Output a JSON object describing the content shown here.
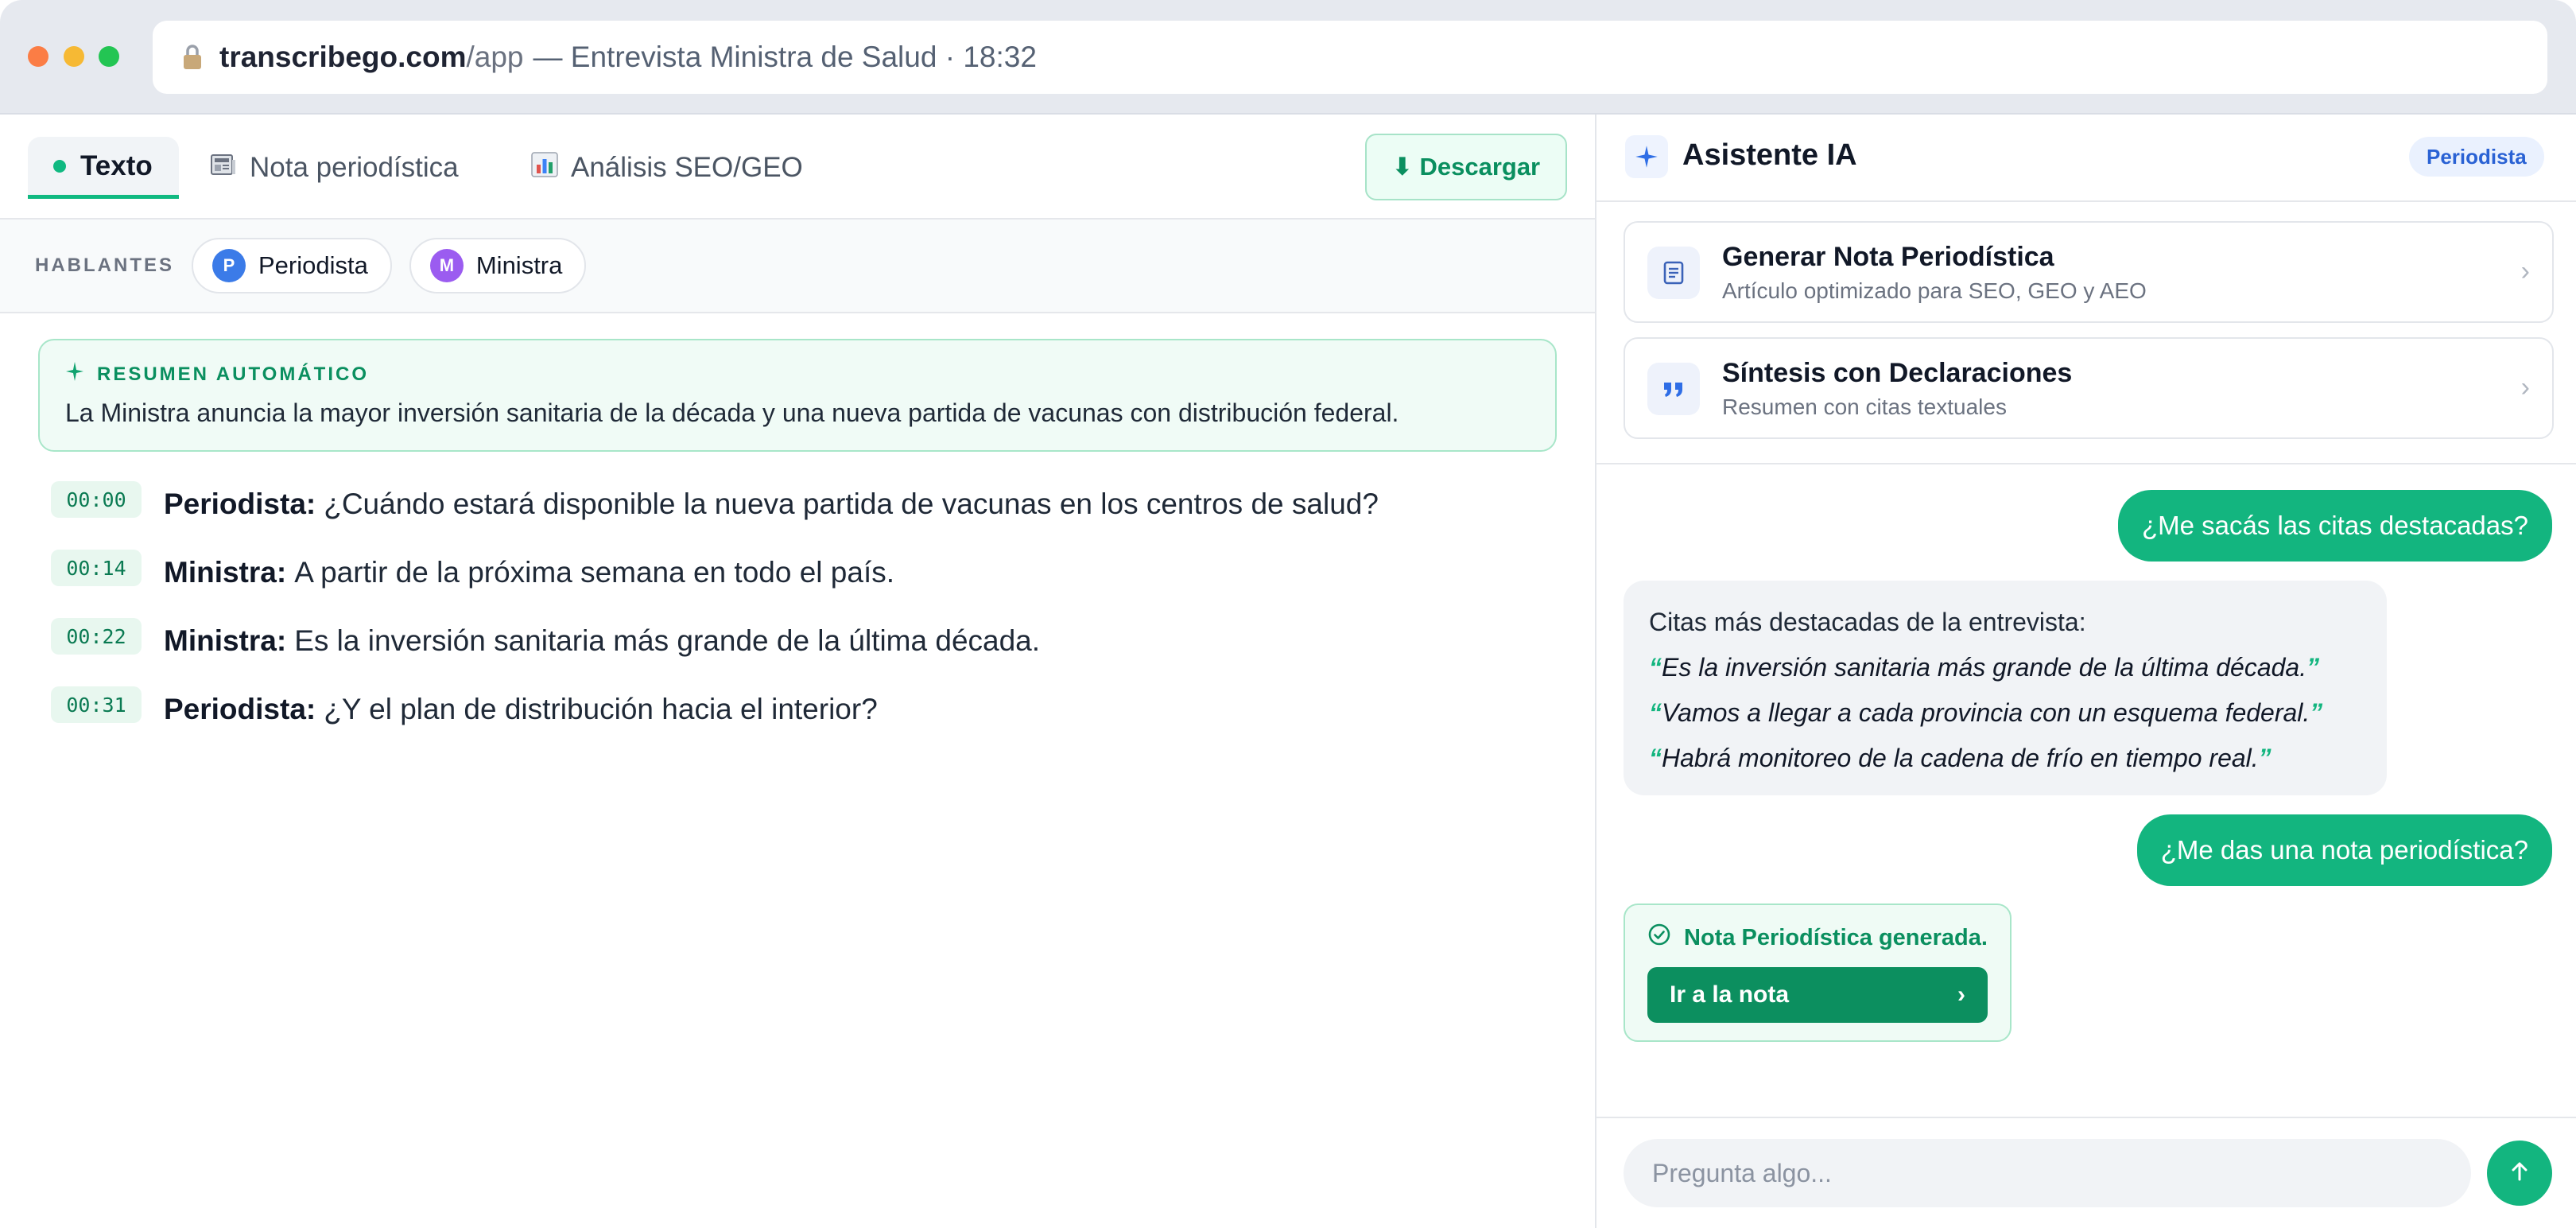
{
  "browser": {
    "url_host": "transcribego.com",
    "url_path": "/app",
    "page_title": "— Entrevista Ministra de Salud · 18:32"
  },
  "tabs": [
    {
      "label": "Texto",
      "icon": "dot-icon",
      "active": true
    },
    {
      "label": "Nota periodística",
      "icon": "newspaper-icon",
      "active": false
    },
    {
      "label": "Análisis SEO/GEO",
      "icon": "bar-chart-icon",
      "active": false
    }
  ],
  "download_label": "⬇ Descargar",
  "speakers": {
    "label": "HABLANTES",
    "items": [
      {
        "initial": "P",
        "name": "Periodista",
        "color": "#3b7be8"
      },
      {
        "initial": "M",
        "name": "Ministra",
        "color": "#9b5cf0"
      }
    ]
  },
  "summary": {
    "title": "RESUMEN AUTOMÁTICO",
    "text": "La Ministra anuncia la mayor inversión sanitaria de la década y una nueva partida de vacunas con distribución federal."
  },
  "transcript": [
    {
      "time": "00:00",
      "speaker": "Periodista:",
      "text": "¿Cuándo estará disponible la nueva partida de vacunas en los centros de salud?"
    },
    {
      "time": "00:14",
      "speaker": "Ministra:",
      "text": "A partir de la próxima semana en todo el país."
    },
    {
      "time": "00:22",
      "speaker": "Ministra:",
      "text": "Es la inversión sanitaria más grande de la última década."
    },
    {
      "time": "00:31",
      "speaker": "Periodista:",
      "text": "¿Y el plan de distribución hacia el interior?"
    }
  ],
  "assistant": {
    "title": "Asistente IA",
    "badge": "Periodista",
    "actions": [
      {
        "title": "Generar Nota Periodística",
        "subtitle": "Artículo optimizado para SEO, GEO y AEO",
        "icon": "document-icon"
      },
      {
        "title": "Síntesis con Declaraciones",
        "subtitle": "Resumen con citas textuales",
        "icon": "quote-icon"
      }
    ],
    "chat": {
      "user_1": "¿Me sacás las citas destacadas?",
      "bot_intro": "Citas más destacadas de la entrevista:",
      "quotes": [
        "Es la inversión sanitaria más grande de la última década.",
        "Vamos a llegar a cada provincia con un esquema federal.",
        "Habrá monitoreo de la cadena de frío en tiempo real."
      ],
      "user_2": "¿Me das una nota periodística?",
      "note_status": "Nota Periodística generada.",
      "note_button": "Ir a la nota"
    },
    "input_placeholder": "Pregunta algo..."
  },
  "colors": {
    "accent": "#13b57f",
    "accent_dark": "#0c8f5f",
    "brand_blue": "#2f6ee6"
  }
}
